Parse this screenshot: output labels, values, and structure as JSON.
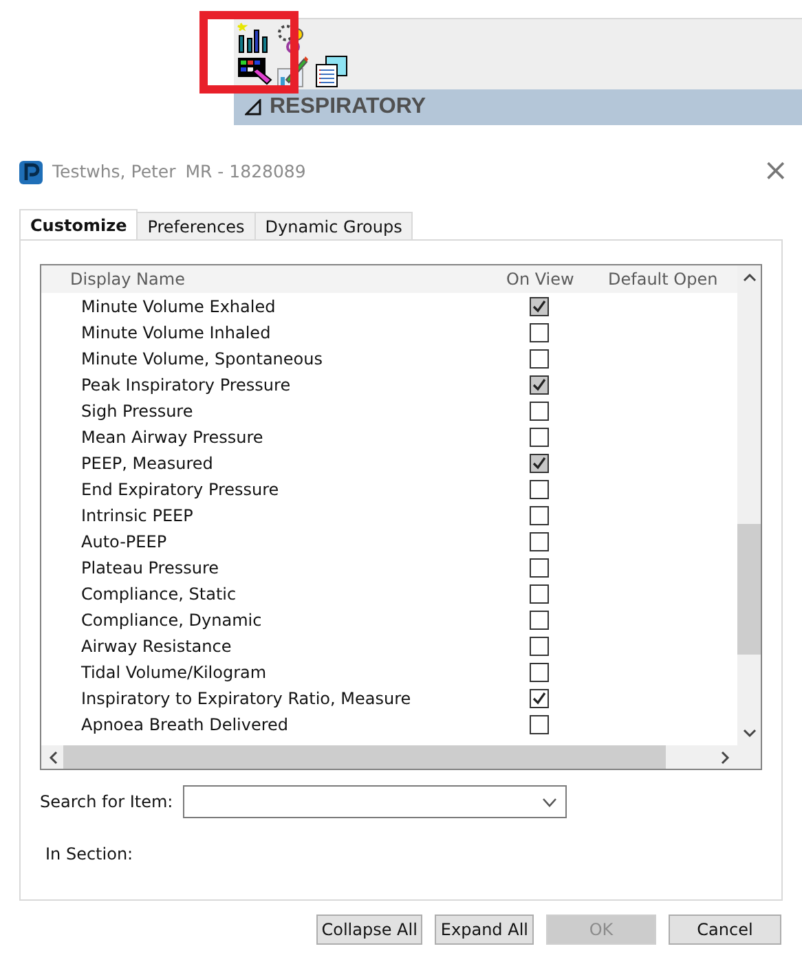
{
  "section_header": {
    "title": "RESPIRATORY"
  },
  "window": {
    "title": "Testwhs, Peter",
    "record": "MR - 1828089",
    "close": "×"
  },
  "tabs": [
    {
      "label": "Customize",
      "selected": true
    },
    {
      "label": "Preferences",
      "selected": false
    },
    {
      "label": "Dynamic Groups",
      "selected": false
    }
  ],
  "table": {
    "columns": [
      "Display Name",
      "On View",
      "Default Open"
    ],
    "rows": [
      {
        "name": "Minute Volume Exhaled",
        "checked": true,
        "disabled": true
      },
      {
        "name": "Minute Volume Inhaled",
        "checked": false,
        "disabled": false
      },
      {
        "name": "Minute Volume, Spontaneous",
        "checked": false,
        "disabled": false
      },
      {
        "name": "Peak Inspiratory Pressure",
        "checked": true,
        "disabled": true
      },
      {
        "name": "Sigh Pressure",
        "checked": false,
        "disabled": false
      },
      {
        "name": "Mean Airway Pressure",
        "checked": false,
        "disabled": false
      },
      {
        "name": "PEEP, Measured",
        "checked": true,
        "disabled": true
      },
      {
        "name": "End Expiratory Pressure",
        "checked": false,
        "disabled": false
      },
      {
        "name": "Intrinsic PEEP",
        "checked": false,
        "disabled": false
      },
      {
        "name": "Auto-PEEP",
        "checked": false,
        "disabled": false
      },
      {
        "name": "Plateau Pressure",
        "checked": false,
        "disabled": false
      },
      {
        "name": "Compliance, Static",
        "checked": false,
        "disabled": false
      },
      {
        "name": "Compliance, Dynamic",
        "checked": false,
        "disabled": false
      },
      {
        "name": "Airway Resistance",
        "checked": false,
        "disabled": false
      },
      {
        "name": "Tidal Volume/Kilogram",
        "checked": false,
        "disabled": false
      },
      {
        "name": "Inspiratory to Expiratory Ratio, Measure",
        "checked": true,
        "disabled": false
      },
      {
        "name": "Apnoea Breath Delivered",
        "checked": false,
        "disabled": false
      }
    ]
  },
  "search": {
    "label": "Search for Item:"
  },
  "section_label": "In Section:",
  "buttons": [
    {
      "label": "Collapse All",
      "disabled": false
    },
    {
      "label": "Expand All",
      "disabled": false
    },
    {
      "label": "OK",
      "disabled": true
    },
    {
      "label": "Cancel",
      "disabled": false
    }
  ]
}
